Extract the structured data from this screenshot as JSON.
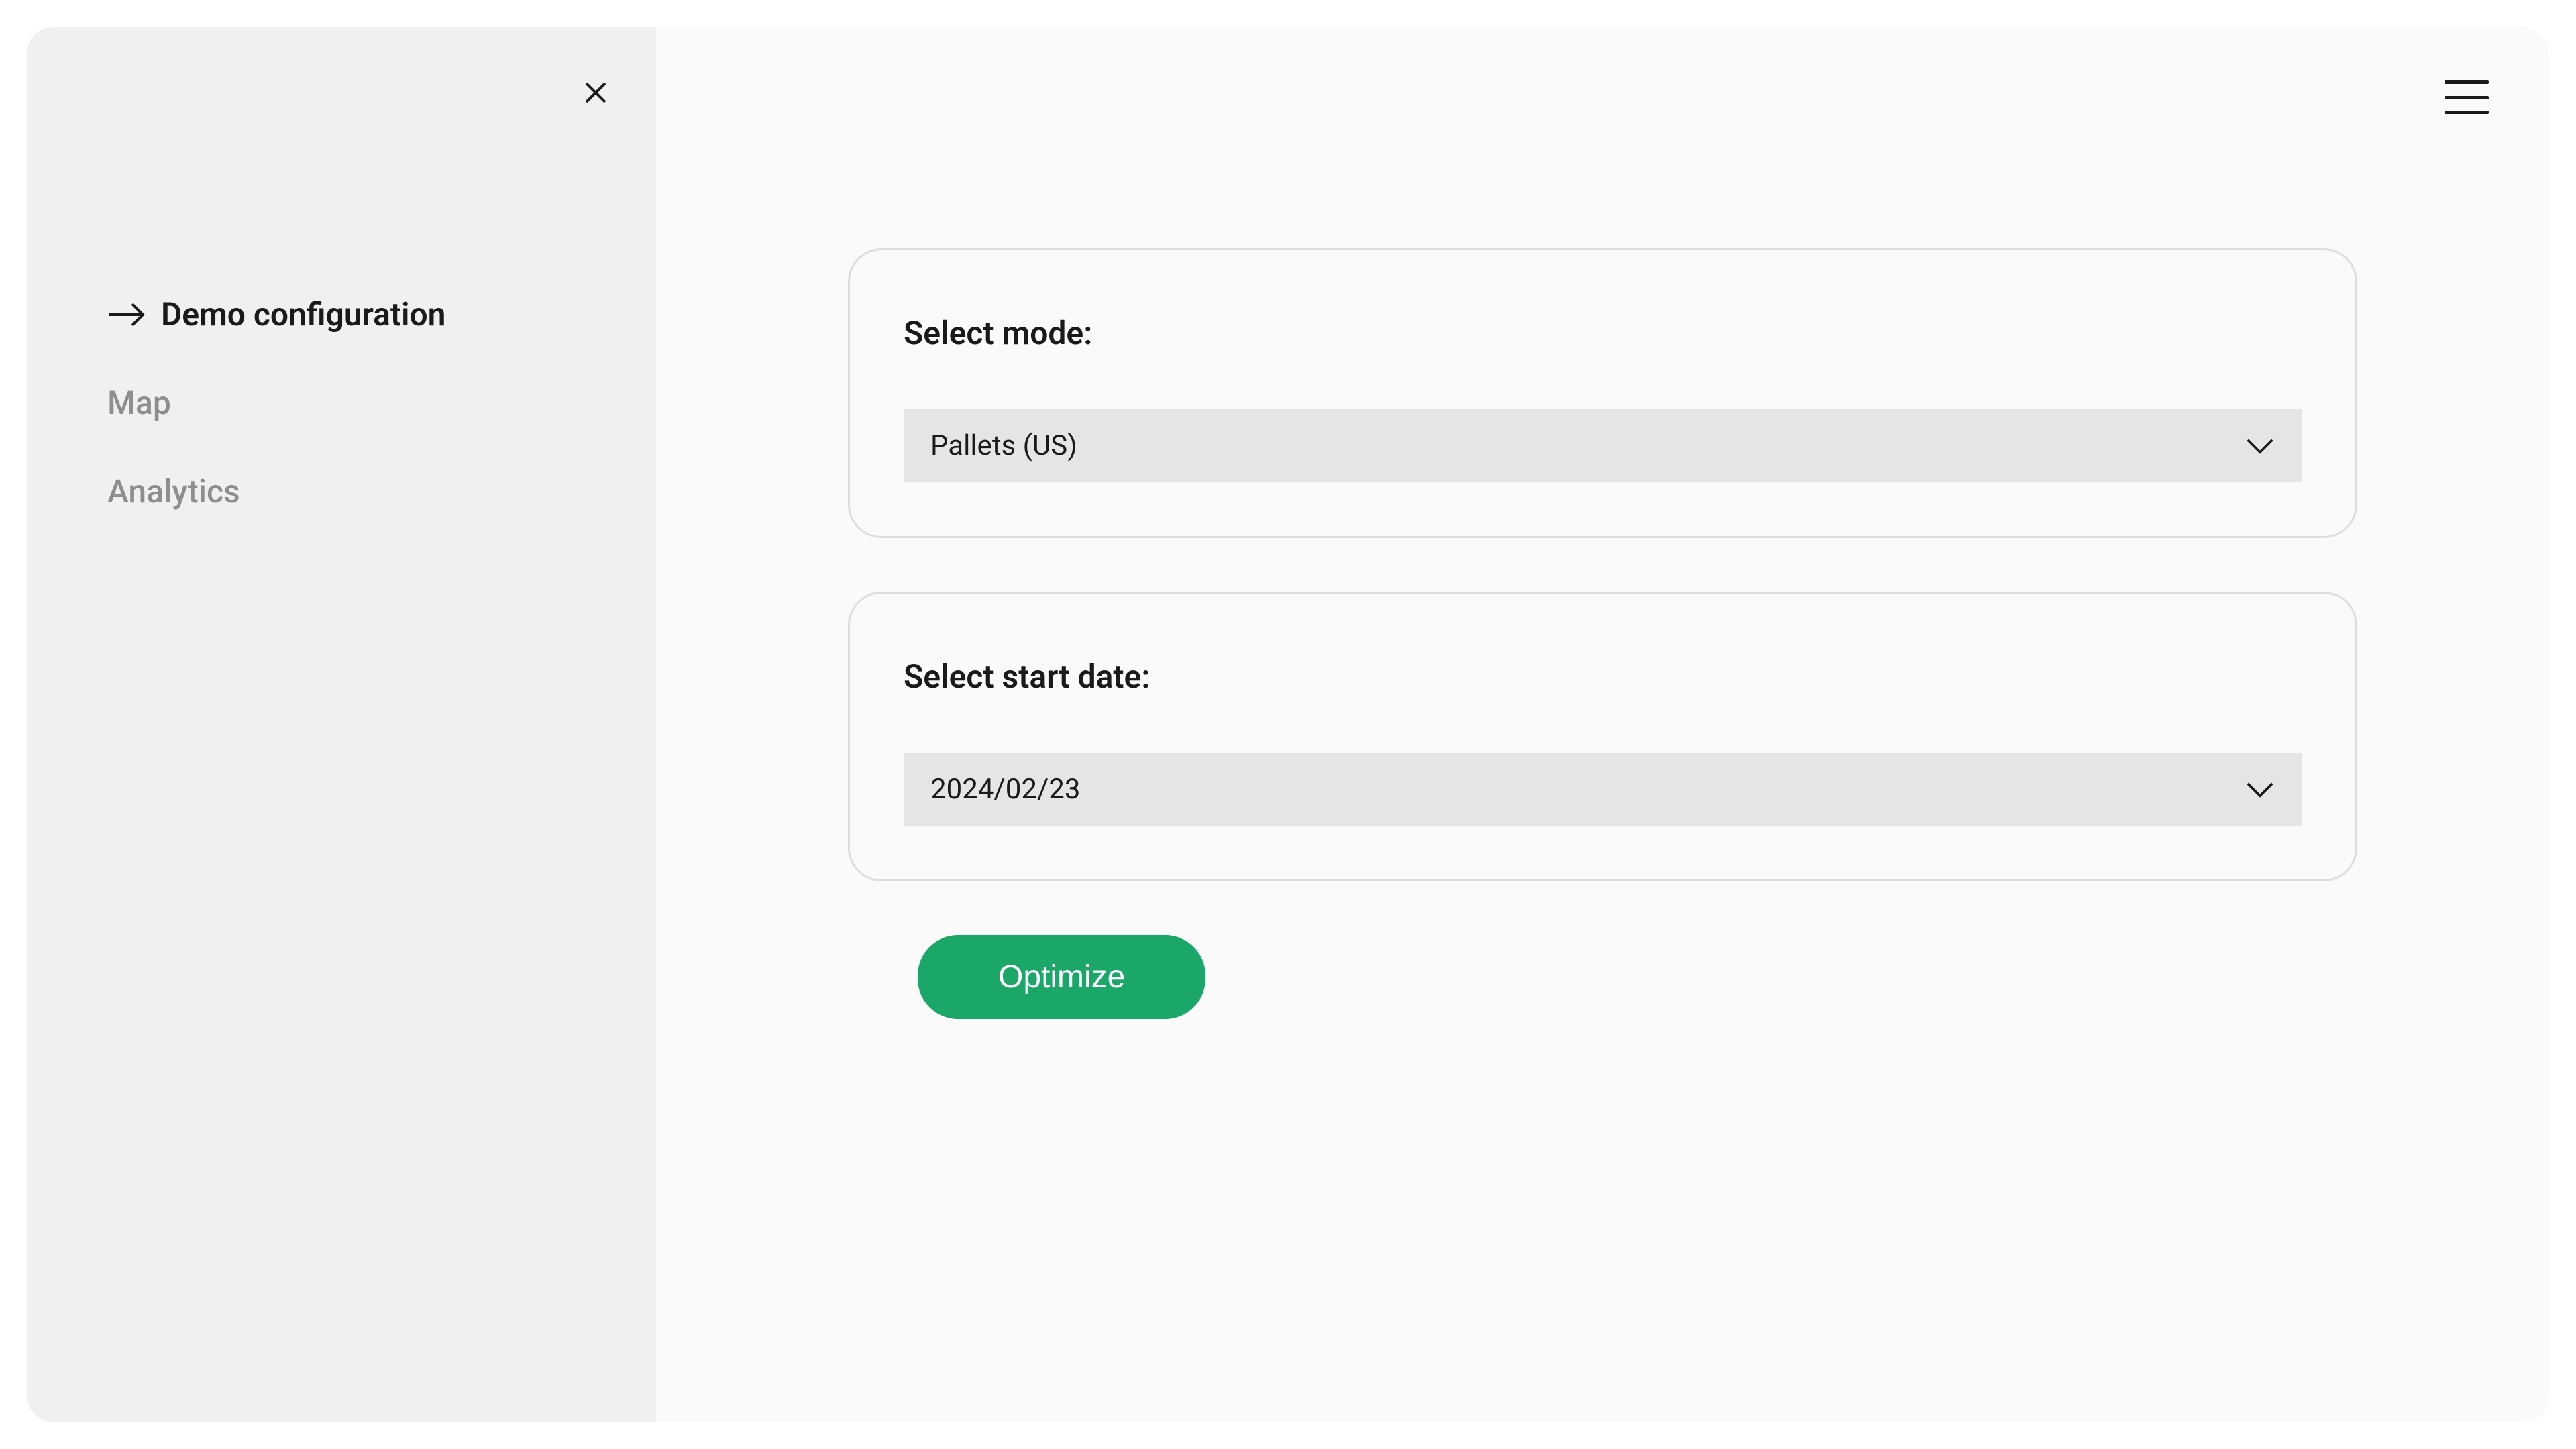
{
  "sidebar": {
    "items": [
      {
        "label": "Demo configuration"
      },
      {
        "label": "Map"
      },
      {
        "label": "Analytics"
      }
    ]
  },
  "main": {
    "mode_section": {
      "label": "Select mode:",
      "selected_value": "Pallets (US)"
    },
    "date_section": {
      "label": "Select start date:",
      "selected_value": "2024/02/23"
    },
    "optimize_button_label": "Optimize"
  },
  "colors": {
    "primary": "#1ba767",
    "text_dark": "#1a1a1a",
    "text_muted": "#8e8e8e",
    "sidebar_bg": "#f0f0f0",
    "main_bg": "#fafafa",
    "field_bg": "#e5e5e5",
    "border": "#ddd"
  }
}
